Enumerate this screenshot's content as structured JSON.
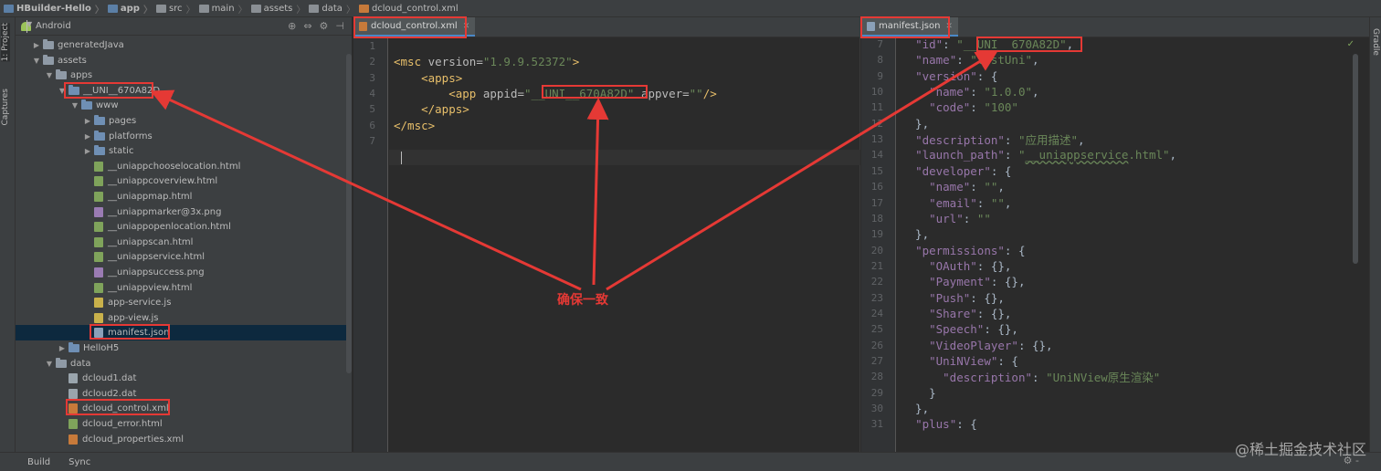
{
  "breadcrumb": [
    {
      "label": "HBuilder-Hello",
      "icon": "project-icon"
    },
    {
      "label": "app",
      "icon": "module-icon"
    },
    {
      "label": "src",
      "icon": "folder-icon"
    },
    {
      "label": "main",
      "icon": "folder-icon"
    },
    {
      "label": "assets",
      "icon": "folder-icon"
    },
    {
      "label": "data",
      "icon": "folder-icon"
    },
    {
      "label": "dcloud_control.xml",
      "icon": "xml-file-icon"
    }
  ],
  "left_strip": {
    "project_tab": "1: Project",
    "captures_tab": "Captures",
    "structure_tab": "ructure"
  },
  "right_strip": {
    "gradle_tab": "Gradle"
  },
  "project_panel": {
    "view_mode": "Android",
    "tree": [
      {
        "label": "generatedJava",
        "depth": 1,
        "type": "folder",
        "expanded": false
      },
      {
        "label": "assets",
        "depth": 1,
        "type": "folder",
        "expanded": true
      },
      {
        "label": "apps",
        "depth": 2,
        "type": "folder",
        "expanded": true
      },
      {
        "label": "__UNI__670A82D",
        "depth": 3,
        "type": "folder",
        "expanded": true
      },
      {
        "label": "www",
        "depth": 4,
        "type": "folder",
        "expanded": true
      },
      {
        "label": "pages",
        "depth": 5,
        "type": "folder",
        "expanded": false
      },
      {
        "label": "platforms",
        "depth": 5,
        "type": "folder",
        "expanded": false
      },
      {
        "label": "static",
        "depth": 5,
        "type": "folder",
        "expanded": false
      },
      {
        "label": "__uniappchooselocation.html",
        "depth": 5,
        "type": "html"
      },
      {
        "label": "__uniappcoverview.html",
        "depth": 5,
        "type": "html"
      },
      {
        "label": "__uniappmap.html",
        "depth": 5,
        "type": "html"
      },
      {
        "label": "__uniappmarker@3x.png",
        "depth": 5,
        "type": "png"
      },
      {
        "label": "__uniappopenlocation.html",
        "depth": 5,
        "type": "html"
      },
      {
        "label": "__uniappscan.html",
        "depth": 5,
        "type": "html"
      },
      {
        "label": "__uniappservice.html",
        "depth": 5,
        "type": "html"
      },
      {
        "label": "__uniappsuccess.png",
        "depth": 5,
        "type": "png"
      },
      {
        "label": "__uniappview.html",
        "depth": 5,
        "type": "html"
      },
      {
        "label": "app-service.js",
        "depth": 5,
        "type": "js"
      },
      {
        "label": "app-view.js",
        "depth": 5,
        "type": "js"
      },
      {
        "label": "manifest.json",
        "depth": 5,
        "type": "json",
        "selected": true
      },
      {
        "label": "HelloH5",
        "depth": 3,
        "type": "folder",
        "expanded": false
      },
      {
        "label": "data",
        "depth": 2,
        "type": "folder",
        "expanded": true
      },
      {
        "label": "dcloud1.dat",
        "depth": 3,
        "type": "dat"
      },
      {
        "label": "dcloud2.dat",
        "depth": 3,
        "type": "dat"
      },
      {
        "label": "dcloud_control.xml",
        "depth": 3,
        "type": "xml"
      },
      {
        "label": "dcloud_error.html",
        "depth": 3,
        "type": "html"
      },
      {
        "label": "dcloud_properties.xml",
        "depth": 3,
        "type": "xml"
      }
    ]
  },
  "editor_left": {
    "tab_label": "dcloud_control.xml",
    "lines": [
      {
        "n": "1",
        "parts": []
      },
      {
        "n": "2",
        "parts": [
          [
            "tag",
            "<msc "
          ],
          [
            "attr",
            "version="
          ],
          [
            "str",
            "\"1.9.9.52372\""
          ],
          [
            "tag",
            ">"
          ]
        ]
      },
      {
        "n": "3",
        "parts": [
          [
            "plain",
            "    "
          ],
          [
            "tag",
            "<apps>"
          ]
        ]
      },
      {
        "n": "4",
        "parts": [
          [
            "plain",
            "        "
          ],
          [
            "tag",
            "<app "
          ],
          [
            "attr",
            "appid="
          ],
          [
            "str",
            "\"__UNI__670A82D\""
          ],
          [
            "attr",
            " appver="
          ],
          [
            "str",
            "\"\""
          ],
          [
            "tag",
            "/>"
          ]
        ]
      },
      {
        "n": "5",
        "parts": [
          [
            "plain",
            "    "
          ],
          [
            "tag",
            "</apps>"
          ]
        ]
      },
      {
        "n": "6",
        "parts": [
          [
            "tag",
            "</msc>"
          ]
        ]
      },
      {
        "n": "7",
        "parts": []
      }
    ]
  },
  "editor_right": {
    "tab_label": "manifest.json",
    "lines": [
      {
        "n": "7",
        "parts": [
          [
            "plain",
            "  "
          ],
          [
            "key",
            "\"id\""
          ],
          [
            "plain",
            ": "
          ],
          [
            "str",
            "\"__UNI__670A82D\""
          ],
          [
            "plain",
            ","
          ]
        ]
      },
      {
        "n": "8",
        "parts": [
          [
            "plain",
            "  "
          ],
          [
            "key",
            "\"name\""
          ],
          [
            "plain",
            ": "
          ],
          [
            "str",
            "\"testUni\""
          ],
          [
            "plain",
            ","
          ]
        ]
      },
      {
        "n": "9",
        "parts": [
          [
            "plain",
            "  "
          ],
          [
            "key",
            "\"version\""
          ],
          [
            "plain",
            ": {"
          ]
        ]
      },
      {
        "n": "10",
        "parts": [
          [
            "plain",
            "    "
          ],
          [
            "key",
            "\"name\""
          ],
          [
            "plain",
            ": "
          ],
          [
            "str",
            "\"1.0.0\""
          ],
          [
            "plain",
            ","
          ]
        ]
      },
      {
        "n": "11",
        "parts": [
          [
            "plain",
            "    "
          ],
          [
            "key",
            "\"code\""
          ],
          [
            "plain",
            ": "
          ],
          [
            "str",
            "\"100\""
          ]
        ]
      },
      {
        "n": "12",
        "parts": [
          [
            "plain",
            "  },"
          ]
        ]
      },
      {
        "n": "13",
        "parts": [
          [
            "plain",
            "  "
          ],
          [
            "key",
            "\"description\""
          ],
          [
            "plain",
            ": "
          ],
          [
            "str",
            "\"应用描述\""
          ],
          [
            "plain",
            ","
          ]
        ]
      },
      {
        "n": "14",
        "parts": [
          [
            "plain",
            "  "
          ],
          [
            "key",
            "\"launch_path\""
          ],
          [
            "plain",
            ": "
          ],
          [
            "str",
            "\""
          ],
          [
            "strul",
            "__uniappservice"
          ],
          [
            "str",
            ".html\""
          ],
          [
            "plain",
            ","
          ]
        ]
      },
      {
        "n": "15",
        "parts": [
          [
            "plain",
            "  "
          ],
          [
            "key",
            "\"developer\""
          ],
          [
            "plain",
            ": {"
          ]
        ]
      },
      {
        "n": "16",
        "parts": [
          [
            "plain",
            "    "
          ],
          [
            "key",
            "\"name\""
          ],
          [
            "plain",
            ": "
          ],
          [
            "str",
            "\"\""
          ],
          [
            "plain",
            ","
          ]
        ]
      },
      {
        "n": "17",
        "parts": [
          [
            "plain",
            "    "
          ],
          [
            "key",
            "\"email\""
          ],
          [
            "plain",
            ": "
          ],
          [
            "str",
            "\"\""
          ],
          [
            "plain",
            ","
          ]
        ]
      },
      {
        "n": "18",
        "parts": [
          [
            "plain",
            "    "
          ],
          [
            "key",
            "\"url\""
          ],
          [
            "plain",
            ": "
          ],
          [
            "str",
            "\"\""
          ]
        ]
      },
      {
        "n": "19",
        "parts": [
          [
            "plain",
            "  },"
          ]
        ]
      },
      {
        "n": "20",
        "parts": [
          [
            "plain",
            "  "
          ],
          [
            "key",
            "\"permissions\""
          ],
          [
            "plain",
            ": {"
          ]
        ]
      },
      {
        "n": "21",
        "parts": [
          [
            "plain",
            "    "
          ],
          [
            "key",
            "\"OAuth\""
          ],
          [
            "plain",
            ": {},"
          ]
        ]
      },
      {
        "n": "22",
        "parts": [
          [
            "plain",
            "    "
          ],
          [
            "key",
            "\"Payment\""
          ],
          [
            "plain",
            ": {},"
          ]
        ]
      },
      {
        "n": "23",
        "parts": [
          [
            "plain",
            "    "
          ],
          [
            "key",
            "\"Push\""
          ],
          [
            "plain",
            ": {},"
          ]
        ]
      },
      {
        "n": "24",
        "parts": [
          [
            "plain",
            "    "
          ],
          [
            "key",
            "\"Share\""
          ],
          [
            "plain",
            ": {},"
          ]
        ]
      },
      {
        "n": "25",
        "parts": [
          [
            "plain",
            "    "
          ],
          [
            "key",
            "\"Speech\""
          ],
          [
            "plain",
            ": {},"
          ]
        ]
      },
      {
        "n": "26",
        "parts": [
          [
            "plain",
            "    "
          ],
          [
            "key",
            "\"VideoPlayer\""
          ],
          [
            "plain",
            ": {},"
          ]
        ]
      },
      {
        "n": "27",
        "parts": [
          [
            "plain",
            "    "
          ],
          [
            "key",
            "\"UniNView\""
          ],
          [
            "plain",
            ": {"
          ]
        ]
      },
      {
        "n": "28",
        "parts": [
          [
            "plain",
            "      "
          ],
          [
            "key",
            "\"description\""
          ],
          [
            "plain",
            ": "
          ],
          [
            "str",
            "\"UniNView原生渲染\""
          ]
        ]
      },
      {
        "n": "29",
        "parts": [
          [
            "plain",
            "    }"
          ]
        ]
      },
      {
        "n": "30",
        "parts": [
          [
            "plain",
            "  },"
          ]
        ]
      },
      {
        "n": "31",
        "parts": [
          [
            "plain",
            "  "
          ],
          [
            "key",
            "\"plus\""
          ],
          [
            "plain",
            ": {"
          ]
        ]
      }
    ]
  },
  "bottom_bar": {
    "build_tab": "Build",
    "sync_tab": "Sync"
  },
  "annotation": {
    "text": "确保一致"
  },
  "watermark": "@稀土掘金技术社区",
  "colors": {
    "annotation": "#e53935",
    "selection": "#0d293e",
    "tab_underline": "#4a88c7"
  }
}
